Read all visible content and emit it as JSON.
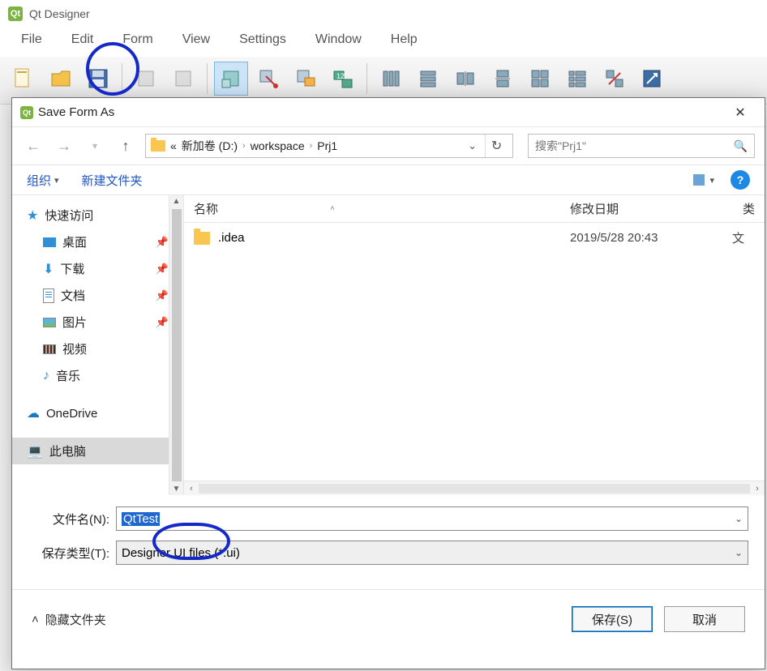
{
  "qt": {
    "title": "Qt Designer",
    "menu": {
      "file": "File",
      "edit": "Edit",
      "form": "Form",
      "view": "View",
      "settings": "Settings",
      "window": "Window",
      "help": "Help"
    }
  },
  "dialog": {
    "title": "Save Form As",
    "breadcrumb": {
      "prefix": "«",
      "drive": "新加卷 (D:)",
      "p1": "workspace",
      "p2": "Prj1"
    },
    "search_placeholder": "搜索\"Prj1\"",
    "cmdbar": {
      "organize": "组织",
      "new_folder": "新建文件夹"
    },
    "sidebar": {
      "quick": "快速访问",
      "desktop": "桌面",
      "downloads": "下载",
      "documents": "文档",
      "pictures": "图片",
      "videos": "视频",
      "music": "音乐",
      "onedrive": "OneDrive",
      "this_pc": "此电脑"
    },
    "columns": {
      "name": "名称",
      "modified": "修改日期",
      "type": "类"
    },
    "rows": [
      {
        "name": ".idea",
        "modified": "2019/5/28 20:43",
        "type": "文"
      }
    ],
    "filename_label": "文件名(N):",
    "filename_value": "QtTest",
    "filetype_label": "保存类型(T):",
    "filetype_value": "Designer UI files (*.ui)",
    "hide_folders": "隐藏文件夹",
    "save_btn": "保存(S)",
    "cancel_btn": "取消"
  }
}
